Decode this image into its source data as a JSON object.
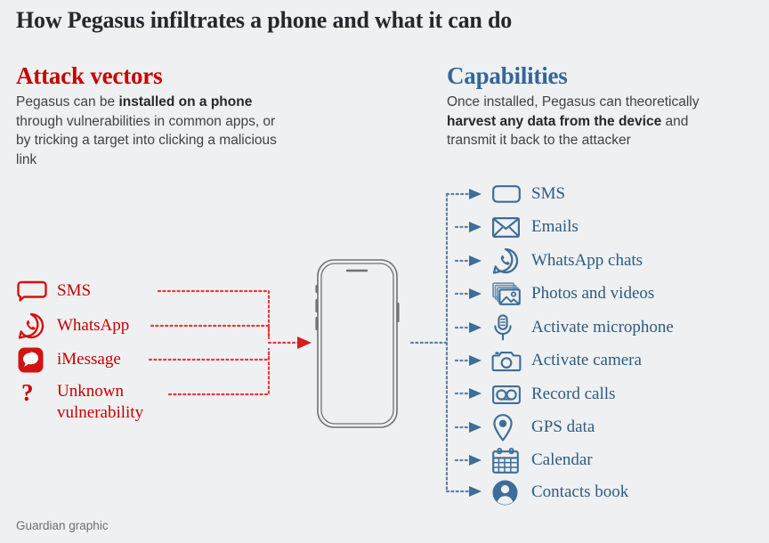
{
  "title": "How Pegasus infiltrates a phone and what it can do",
  "footer": "Guardian graphic",
  "colors": {
    "background": "#eff0f1",
    "attack_red": "#c70000",
    "capability_blue": "#336699",
    "icon_blue": "#3d6e99",
    "label_blue": "#2b5c85",
    "body_text": "#3f4244",
    "title_text": "#25282a",
    "phone_outline": "#6e7376",
    "footer_text": "#6b7073"
  },
  "attack": {
    "heading": "Attack vectors",
    "body": {
      "part1": "Pegasus can be ",
      "bold1": "installed on a phone",
      "part2": " through vulnerabilities in common apps, or by tricking a target into clicking a malicious link"
    },
    "items": [
      {
        "label": "SMS",
        "icon": "sms-bubble-icon"
      },
      {
        "label": "WhatsApp",
        "icon": "whatsapp-icon"
      },
      {
        "label": "iMessage",
        "icon": "imessage-icon"
      },
      {
        "label": "Unknown vulnerability",
        "icon": "question-mark-icon"
      }
    ]
  },
  "capabilities": {
    "heading": "Capabilities",
    "body": {
      "part1": "Once installed, Pegasus can theoretically ",
      "bold1": "harvest any data from the device",
      "part2": " and transmit it back to the attacker"
    },
    "items": [
      {
        "label": "SMS",
        "icon": "sms-bubble-icon"
      },
      {
        "label": "Emails",
        "icon": "envelope-icon"
      },
      {
        "label": "WhatsApp chats",
        "icon": "whatsapp-icon"
      },
      {
        "label": "Photos and videos",
        "icon": "photos-stack-icon"
      },
      {
        "label": "Activate microphone",
        "icon": "microphone-icon"
      },
      {
        "label": "Activate camera",
        "icon": "camera-icon"
      },
      {
        "label": "Record calls",
        "icon": "tape-recorder-icon"
      },
      {
        "label": "GPS data",
        "icon": "map-pin-icon"
      },
      {
        "label": "Calendar",
        "icon": "calendar-icon"
      },
      {
        "label": "Contacts book",
        "icon": "contact-person-icon"
      }
    ]
  },
  "phone": {
    "icon": "smartphone-outline"
  }
}
